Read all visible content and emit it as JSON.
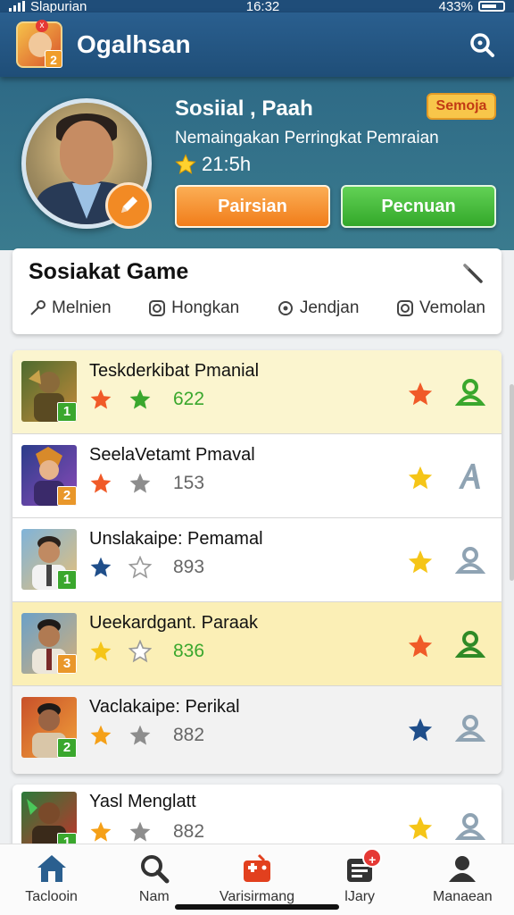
{
  "status_bar": {
    "carrier": "Slapurian",
    "time": "16:32",
    "battery": "433%"
  },
  "app_bar": {
    "title": "Ogalhsan",
    "logo_badge": "2",
    "logo_dot": "x",
    "search_icon": "search-icon"
  },
  "profile": {
    "name": "Sosiial , Paah",
    "tag": "Semoja",
    "subtitle": "Nemaingakan Perringkat Pemraian",
    "score": "21:5h",
    "btn_primary": "Pairsian",
    "btn_secondary": "Pecnuan",
    "edit_icon": "pencil-icon"
  },
  "social": {
    "title": "Sosiakat Game",
    "tabs": [
      "Melnien",
      "Hongkan",
      "Jendjan",
      "Vemolan"
    ]
  },
  "rows": [
    {
      "name": "Teskderkibat Pmanial",
      "rank": "1",
      "value": "622",
      "value_color": "green",
      "highlight": "hl"
    },
    {
      "name": "SeelaVetamt Pmaval",
      "rank": "2",
      "value": "153",
      "value_color": "gray",
      "highlight": ""
    },
    {
      "name": "Unslakaipe: Pemamal",
      "rank": "1",
      "value": "893",
      "value_color": "gray",
      "highlight": ""
    },
    {
      "name": "Ueekardgant. Paraak",
      "rank": "3",
      "value": "836",
      "value_color": "green",
      "highlight": "hl2"
    },
    {
      "name": "Vaclakaipe: Perikal",
      "rank": "2",
      "value": "882",
      "value_color": "gray",
      "highlight": "dim"
    },
    {
      "name": "Yasl Menglatt",
      "rank": "1",
      "value": "882",
      "value_color": "gray",
      "highlight": ""
    }
  ],
  "bottom_nav": [
    {
      "label": "Taclooin",
      "icon": "home-icon"
    },
    {
      "label": "Nam",
      "icon": "search-icon"
    },
    {
      "label": "Varisirmang",
      "icon": "gamepad-icon"
    },
    {
      "label": "lJary",
      "icon": "list-icon",
      "badge": "+"
    },
    {
      "label": "Manaean",
      "icon": "user-icon"
    }
  ]
}
